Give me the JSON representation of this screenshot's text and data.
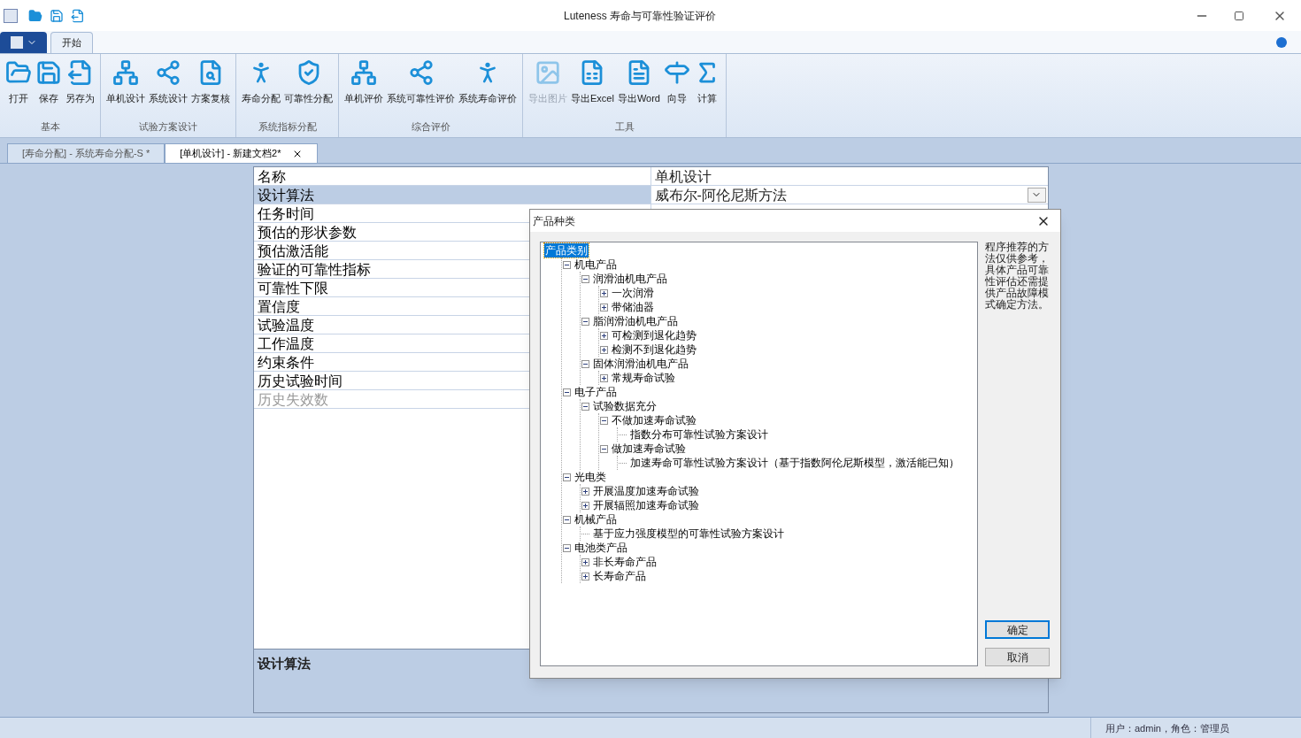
{
  "window": {
    "title": "Luteness 寿命与可靠性验证评价"
  },
  "ribbon_tabs": [
    {
      "label": "开始",
      "selected": true
    }
  ],
  "ribbon_groups": [
    {
      "label": "基本",
      "buttons": [
        {
          "label": "打开",
          "disabled": false
        },
        {
          "label": "保存",
          "disabled": false
        },
        {
          "label": "另存为",
          "disabled": false
        }
      ]
    },
    {
      "label": "试验方案设计",
      "buttons": [
        {
          "label": "单机设计",
          "disabled": false
        },
        {
          "label": "系统设计",
          "disabled": false
        },
        {
          "label": "方案复核",
          "disabled": false
        }
      ]
    },
    {
      "label": "系统指标分配",
      "buttons": [
        {
          "label": "寿命分配",
          "disabled": false
        },
        {
          "label": "可靠性分配",
          "disabled": false
        }
      ]
    },
    {
      "label": "综合评价",
      "buttons": [
        {
          "label": "单机评价",
          "disabled": false
        },
        {
          "label": "系统可靠性评价",
          "disabled": false
        },
        {
          "label": "系统寿命评价",
          "disabled": false
        }
      ]
    },
    {
      "label": "工具",
      "buttons": [
        {
          "label": "导出图片",
          "disabled": true
        },
        {
          "label": "导出Excel",
          "disabled": false
        },
        {
          "label": "导出Word",
          "disabled": false
        },
        {
          "label": "向导",
          "disabled": false
        },
        {
          "label": "计算",
          "disabled": false
        }
      ]
    }
  ],
  "doc_tabs": [
    {
      "label": "[寿命分配] - 系统寿命分配-S *",
      "selected": false
    },
    {
      "label": "[单机设计] - 新建文档2*",
      "selected": true
    }
  ],
  "properties": [
    {
      "name": "名称",
      "value": "单机设计",
      "selected": false,
      "disabled": false
    },
    {
      "name": "设计算法",
      "value": "威布尔-阿伦尼斯方法",
      "selected": true,
      "disabled": false,
      "kind": "dropdown"
    },
    {
      "name": "任务时间",
      "selected": false,
      "disabled": false
    },
    {
      "name": "预估的形状参数",
      "selected": false,
      "disabled": false
    },
    {
      "name": "预估激活能",
      "selected": false,
      "disabled": false
    },
    {
      "name": "验证的可靠性指标",
      "selected": false,
      "disabled": false
    },
    {
      "name": "可靠性下限",
      "selected": false,
      "disabled": false
    },
    {
      "name": "置信度",
      "selected": false,
      "disabled": false
    },
    {
      "name": "试验温度",
      "selected": false,
      "disabled": false
    },
    {
      "name": "工作温度",
      "selected": false,
      "disabled": false
    },
    {
      "name": "约束条件",
      "selected": false,
      "disabled": false
    },
    {
      "name": "历史试验时间",
      "selected": false,
      "disabled": false
    },
    {
      "name": "历史失效数",
      "selected": false,
      "disabled": true
    }
  ],
  "description": {
    "title": "设计算法"
  },
  "dialog": {
    "title": "产品种类",
    "tree": [
      {
        "label": "产品类别",
        "selected": true,
        "children": [
          {
            "label": "机电产品",
            "expanded": true,
            "selected": false,
            "children": [
              {
                "label": "润滑油机电产品",
                "expanded": true,
                "selected": false,
                "children": [
                  {
                    "label": "一次润滑",
                    "expanded": false,
                    "selected": false
                  },
                  {
                    "label": "带储油器",
                    "expanded": false,
                    "selected": false
                  }
                ]
              },
              {
                "label": "脂润滑油机电产品",
                "expanded": true,
                "selected": false,
                "children": [
                  {
                    "label": "可检测到退化趋势",
                    "expanded": false,
                    "selected": false
                  },
                  {
                    "label": "检测不到退化趋势",
                    "expanded": false,
                    "selected": false
                  }
                ]
              },
              {
                "label": "固体润滑油机电产品",
                "expanded": true,
                "selected": false,
                "children": [
                  {
                    "label": "常规寿命试验",
                    "expanded": false,
                    "selected": false
                  }
                ]
              }
            ]
          },
          {
            "label": "电子产品",
            "expanded": true,
            "selected": false,
            "children": [
              {
                "label": "试验数据充分",
                "expanded": true,
                "selected": false,
                "children": [
                  {
                    "label": "不做加速寿命试验",
                    "expanded": true,
                    "selected": false,
                    "children": [
                      {
                        "label": "指数分布可靠性试验方案设计",
                        "selected": false
                      }
                    ]
                  },
                  {
                    "label": "做加速寿命试验",
                    "expanded": true,
                    "selected": false,
                    "children": [
                      {
                        "label": "加速寿命可靠性试验方案设计（基于指数阿伦尼斯模型，激活能已知）",
                        "selected": false
                      }
                    ]
                  }
                ]
              }
            ]
          },
          {
            "label": "光电类",
            "expanded": true,
            "selected": false,
            "children": [
              {
                "label": "开展温度加速寿命试验",
                "expanded": false,
                "selected": false
              },
              {
                "label": "开展辐照加速寿命试验",
                "expanded": false,
                "selected": false
              }
            ]
          },
          {
            "label": "机械产品",
            "expanded": true,
            "selected": false,
            "children": [
              {
                "label": "基于应力强度模型的可靠性试验方案设计",
                "selected": false
              }
            ]
          },
          {
            "label": "电池类产品",
            "expanded": true,
            "selected": false,
            "children": [
              {
                "label": "非长寿命产品",
                "expanded": false,
                "selected": false
              },
              {
                "label": "长寿命产品",
                "expanded": false,
                "selected": false
              }
            ]
          }
        ]
      }
    ],
    "note": "程序推荐的方法仅供参考，具体产品可靠性评估还需提供产品故障模式确定方法。",
    "buttons": [
      {
        "label": "确定",
        "selected": true
      },
      {
        "label": "取消",
        "selected": false
      }
    ]
  },
  "status_bar": {
    "text": "用户：admin，角色：管理员"
  }
}
